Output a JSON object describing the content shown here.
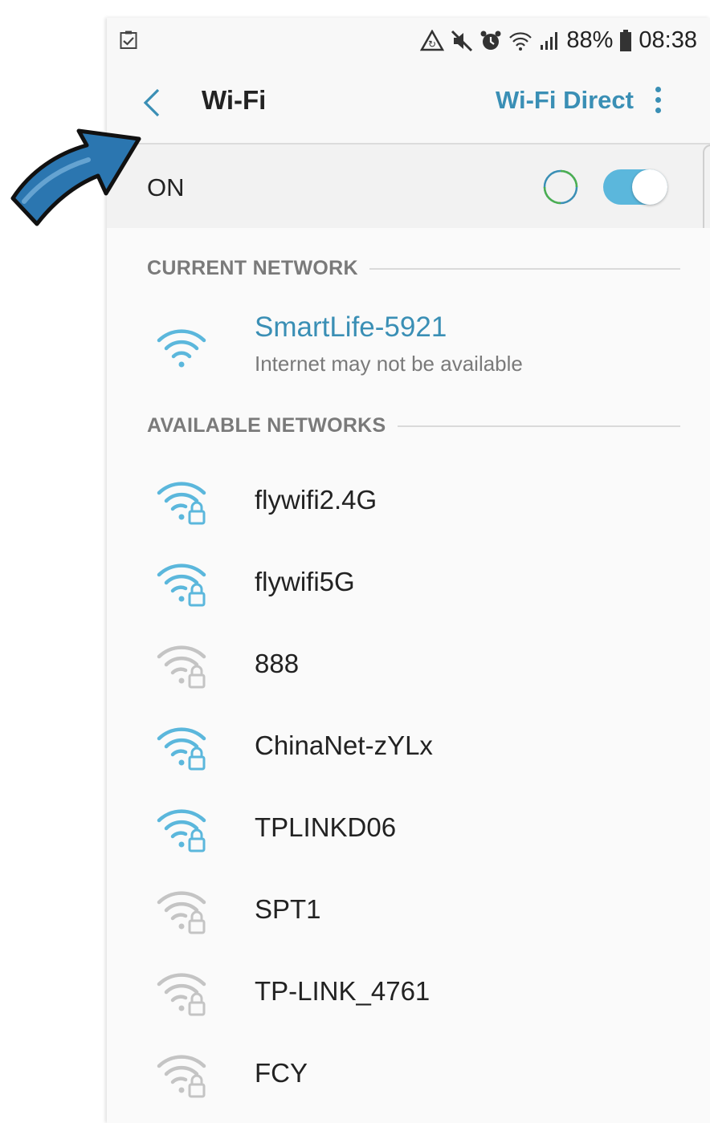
{
  "status_bar": {
    "battery_percent": "88%",
    "time": "08:38",
    "icons": [
      "checklist-icon",
      "data-saver-icon",
      "mute-icon",
      "alarm-icon",
      "wifi-status-icon",
      "signal-icon",
      "battery-icon"
    ]
  },
  "header": {
    "title": "Wi-Fi",
    "wifi_direct_label": "Wi-Fi Direct"
  },
  "toggle_row": {
    "label": "ON",
    "state": true
  },
  "current_network": {
    "header": "CURRENT NETWORK",
    "name": "SmartLife-5921",
    "status": "Internet may not be available"
  },
  "available_networks": {
    "header": "AVAILABLE NETWORKS",
    "items": [
      {
        "name": "flywifi2.4G",
        "strength": "strong",
        "secured": true
      },
      {
        "name": "flywifi5G",
        "strength": "strong",
        "secured": true
      },
      {
        "name": "888",
        "strength": "weak",
        "secured": true
      },
      {
        "name": "ChinaNet-zYLx",
        "strength": "strong",
        "secured": true
      },
      {
        "name": "TPLINKD06",
        "strength": "strong",
        "secured": true
      },
      {
        "name": "SPT1",
        "strength": "weak",
        "secured": true
      },
      {
        "name": "TP-LINK_4761",
        "strength": "weak",
        "secured": true
      },
      {
        "name": "FCY",
        "strength": "weak",
        "secured": true
      }
    ]
  },
  "colors": {
    "accent": "#3a8fb5",
    "wifi_strong": "#5bb7dc",
    "wifi_weak": "#c4c4c4",
    "annotation_arrow": "#2b76b0"
  }
}
